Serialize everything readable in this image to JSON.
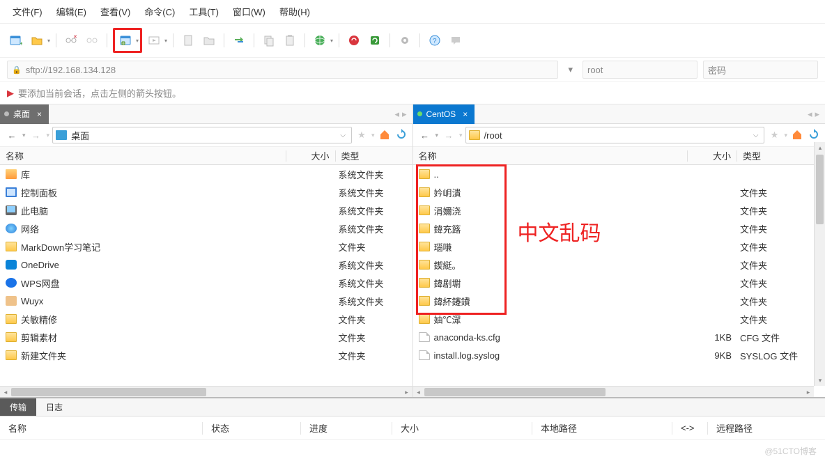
{
  "menu": {
    "file": "文件(F)",
    "edit": "编辑(E)",
    "view": "查看(V)",
    "command": "命令(C)",
    "tools": "工具(T)",
    "window": "窗口(W)",
    "help": "帮助(H)"
  },
  "address": {
    "url": "sftp://192.168.134.128",
    "user": "root",
    "pass_placeholder": "密码"
  },
  "hint": "要添加当前会话，点击左侧的箭头按钮。",
  "left": {
    "tab": "桌面",
    "path": "桌面",
    "cols": {
      "name": "名称",
      "size": "大小",
      "type": "类型"
    },
    "items": [
      {
        "name": "库",
        "type": "系统文件夹",
        "icon": "lib"
      },
      {
        "name": "控制面板",
        "type": "系统文件夹",
        "icon": "panel"
      },
      {
        "name": "此电脑",
        "type": "系统文件夹",
        "icon": "pc"
      },
      {
        "name": "网络",
        "type": "系统文件夹",
        "icon": "net"
      },
      {
        "name": "MarkDown学习笔记",
        "type": "文件夹",
        "icon": "folder"
      },
      {
        "name": "OneDrive",
        "type": "系统文件夹",
        "icon": "onedrive"
      },
      {
        "name": "WPS网盘",
        "type": "系统文件夹",
        "icon": "wps"
      },
      {
        "name": "Wuyx",
        "type": "系统文件夹",
        "icon": "user"
      },
      {
        "name": "关敏精修",
        "type": "文件夹",
        "icon": "folder"
      },
      {
        "name": "剪辑素材",
        "type": "文件夹",
        "icon": "folder"
      },
      {
        "name": "新建文件夹",
        "type": "文件夹",
        "icon": "folder"
      }
    ]
  },
  "right": {
    "tab": "CentOS",
    "path": "/root",
    "cols": {
      "name": "名称",
      "size": "大小",
      "type": "类型"
    },
    "items": [
      {
        "name": "妗岄潰",
        "size": "",
        "type": "文件夹",
        "icon": "folder"
      },
      {
        "name": "涓嬭浇",
        "size": "",
        "type": "文件夹",
        "icon": "folder"
      },
      {
        "name": "鍏充簬",
        "size": "",
        "type": "文件夹",
        "icon": "folder"
      },
      {
        "name": "瑙嗛",
        "size": "",
        "type": "文件夹",
        "icon": "folder"
      },
      {
        "name": "鍥綎。",
        "size": "",
        "type": "文件夹",
        "icon": "folder"
      },
      {
        "name": "鍏剧墛",
        "size": "",
        "type": "文件夹",
        "icon": "folder"
      },
      {
        "name": "鍏紑鑳鐨",
        "size": "",
        "type": "文件夹",
        "icon": "folder"
      },
      {
        "name": "妯℃潀",
        "size": "",
        "type": "文件夹",
        "icon": "folder"
      },
      {
        "name": "anaconda-ks.cfg",
        "size": "1KB",
        "type": "CFG 文件",
        "icon": "file"
      },
      {
        "name": "install.log.syslog",
        "size": "9KB",
        "type": "SYSLOG 文件",
        "icon": "file"
      }
    ]
  },
  "annotation": "中文乱码",
  "bottom": {
    "tabs": {
      "transfer": "传输",
      "log": "日志"
    },
    "cols": {
      "name": "名称",
      "status": "状态",
      "progress": "进度",
      "size": "大小",
      "lpath": "本地路径",
      "arrow": "<->",
      "rpath": "远程路径"
    }
  },
  "watermark": "@51CTO博客"
}
